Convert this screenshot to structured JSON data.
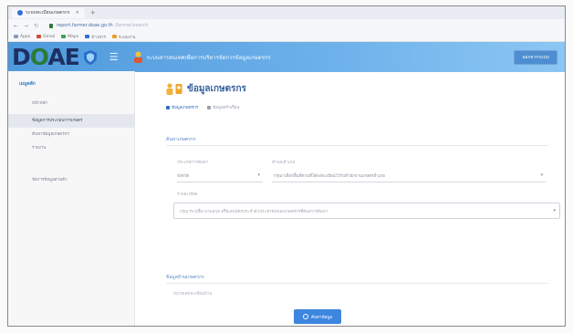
{
  "browser": {
    "tab_title": "ระบบทะเบียนเกษตรกร",
    "tab_close": "×",
    "new_tab": "+",
    "nav_back": "←",
    "nav_forward": "→",
    "nav_reload": "↻",
    "url_main": "report.farmer.doae.go.th",
    "url_rest": "/farmer/search",
    "bookmarks": [
      "Apps",
      "Gmail",
      "Maps",
      "ข่าวสาร",
      "ระบบงาน"
    ]
  },
  "header": {
    "logo_text_d": "D",
    "logo_text_o": "O",
    "logo_text_ae": "AE",
    "menu_icon": "☰",
    "app_title": "ระบบสารสนเทศเพื่อการบริหารจัดการข้อมูลเกษตรกร",
    "logout_label": "ออกจากระบบ"
  },
  "sidebar": {
    "header": "เมนูหลัก",
    "items": [
      {
        "label": "หน้าหลัก",
        "active": false
      },
      {
        "label": "ข้อมูลการประกอบการเกษตร",
        "active": true
      },
      {
        "label": "ค้นหาข้อมูลเกษตรกร",
        "active": false
      },
      {
        "label": "รายงาน",
        "active": false
      },
      {
        "label": "จัดการข้อมูลส่วนตัว",
        "active": false
      }
    ]
  },
  "main": {
    "page_title": "ข้อมูลเกษตรกร",
    "tabs": [
      {
        "label": "ข้อมูลเกษตรกร"
      },
      {
        "label": "ข้อมูลครัวเรือน"
      }
    ],
    "section1": "ค้นหาเกษตรกร",
    "field_type_label": "ประเภทการค้นหา",
    "field_type_value": "จังหวัด",
    "field_area_label": "ตำบล/อำเภอ",
    "field_area_value": "กรุณาเลือกพื้นที่ตามที่ได้ลงทะเบียนไว้กับสำนักงานเกษตรอำเภอ",
    "field_detail_label": "รายละเอียด",
    "field_detail_value": "กรุณาระบุชื่อ-นามสกุล หรือเลขบัตรประจำตัวประชาชนของเกษตรกรที่ต้องการค้นหา",
    "section2": "ข้อมูลบ้านเกษตรกร",
    "field_house_label": "หมายเลขทะเบียนบ้าน",
    "search_label": "ค้นหาข้อมูล"
  },
  "colors": {
    "header_gradient_start": "#4e99dc",
    "accent": "#3d86e0",
    "logo_navy": "#1d2f63",
    "logo_green": "#2a7a3b"
  }
}
